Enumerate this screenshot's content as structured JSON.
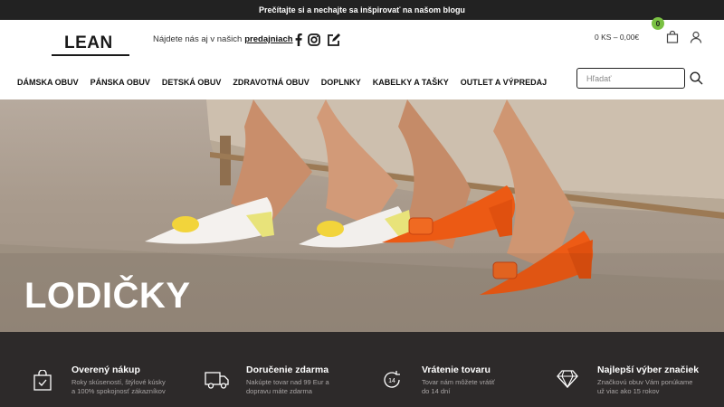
{
  "topbar": {
    "text": "Prečítajte si a nechajte sa inšpirovať na našom blogu"
  },
  "header": {
    "logo_text": "LEAN",
    "find_us_text": "Nájdete nás aj v našich",
    "find_us_link": "predajniach",
    "social_icons": [
      "facebook-icon",
      "instagram-icon",
      "blog-edit-icon"
    ],
    "cart_total": "0 KS – 0,00€",
    "cart_count": "0",
    "accent_color": "#7ac143"
  },
  "nav": {
    "items": [
      {
        "label": "DÁMSKA OBUV"
      },
      {
        "label": "PÁNSKA OBUV"
      },
      {
        "label": "DETSKÁ OBUV"
      },
      {
        "label": "ZDRAVOTNÁ OBUV"
      },
      {
        "label": "DOPLNKY"
      },
      {
        "label": "KABELKY A TAŠKY"
      },
      {
        "label": "OUTLET A VÝPREDAJ"
      }
    ]
  },
  "search": {
    "placeholder": "Hľadať",
    "value": ""
  },
  "hero": {
    "title": "LODIČKY"
  },
  "features": [
    {
      "icon": "shopping-bag-check-icon",
      "title": "Overený nákup",
      "desc_1": "Roky skúseností, štýlové kúsky",
      "desc_2": "a 100% spokojnosť zákazníkov"
    },
    {
      "icon": "delivery-truck-icon",
      "title": "Doručenie zdarma",
      "desc_1": "Nakúpte tovar nad 99 Eur a",
      "desc_2": "dopravu máte zdarma"
    },
    {
      "icon": "return-14-days-icon",
      "title": "Vrátenie tovaru",
      "desc_1": "Tovar nám môžete vrátiť",
      "desc_2": "do 14 dní"
    },
    {
      "icon": "diamond-icon",
      "title": "Najlepší výber značiek",
      "desc_1": "Značkovú obuv Vám ponúkame",
      "desc_2": "už viac ako 15 rokov"
    }
  ]
}
